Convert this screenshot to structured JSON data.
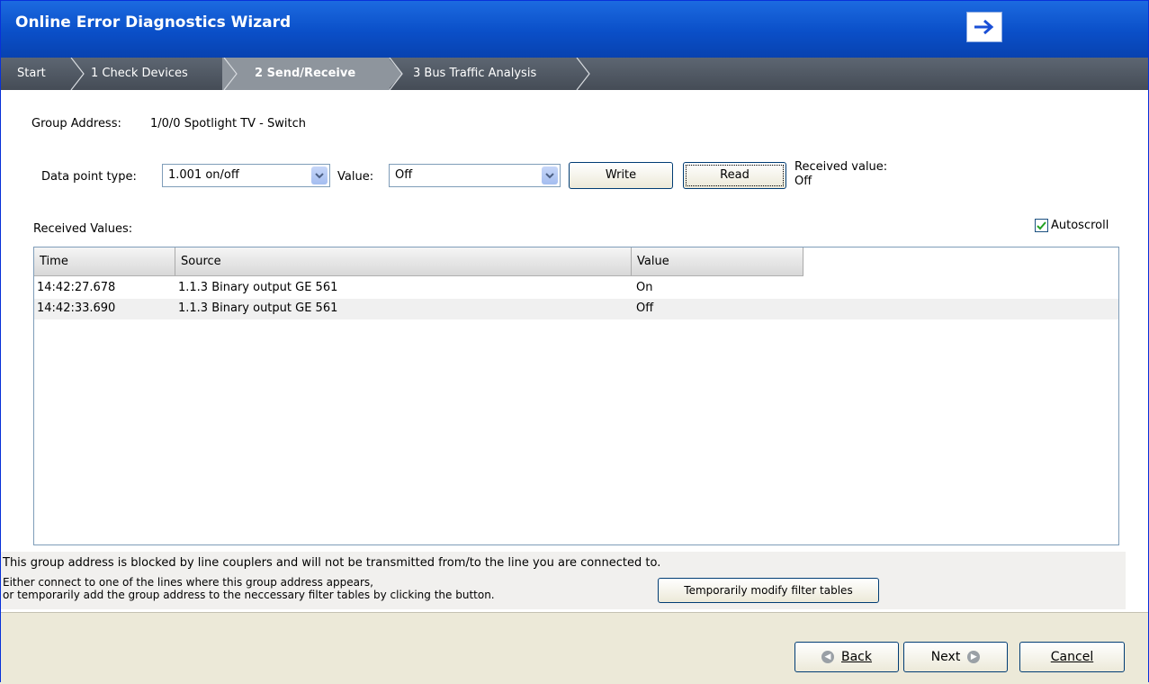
{
  "window": {
    "title": "Online Error Diagnostics Wizard"
  },
  "breadcrumb": [
    {
      "label": "Start"
    },
    {
      "label": "1 Check Devices"
    },
    {
      "label": "2 Send/Receive"
    },
    {
      "label": "3 Bus Traffic Analysis"
    }
  ],
  "group": {
    "label": "Group Address:",
    "value": "1/0/0 Spotlight TV - Switch"
  },
  "datapoint": {
    "label": "Data point type:",
    "selected": "1.001 on/off"
  },
  "value": {
    "label": "Value:",
    "selected": "Off"
  },
  "buttons": {
    "write": "Write",
    "read": "Read",
    "modify": "Temporarily modify filter tables",
    "back": "Back",
    "next": "Next",
    "cancel": "Cancel"
  },
  "received": {
    "label": "Received value:",
    "value": "Off"
  },
  "list": {
    "label": "Received Values:",
    "autoscroll": "Autoscroll",
    "columns": [
      "Time",
      "Source",
      "Value"
    ],
    "rows": [
      {
        "time": "14:42:27.678",
        "source": "1.1.3  Binary output GE 561",
        "value": "On"
      },
      {
        "time": "14:42:33.690",
        "source": "1.1.3  Binary output GE 561",
        "value": "Off"
      }
    ]
  },
  "notice": {
    "line1": "This group address is blocked by line couplers and will not be transmitted from/to the line you are connected to.",
    "line2": "Either connect to one of the lines where this group address appears,",
    "line3": "or temporarily add the group address to the neccessary filter tables by clicking the button."
  }
}
